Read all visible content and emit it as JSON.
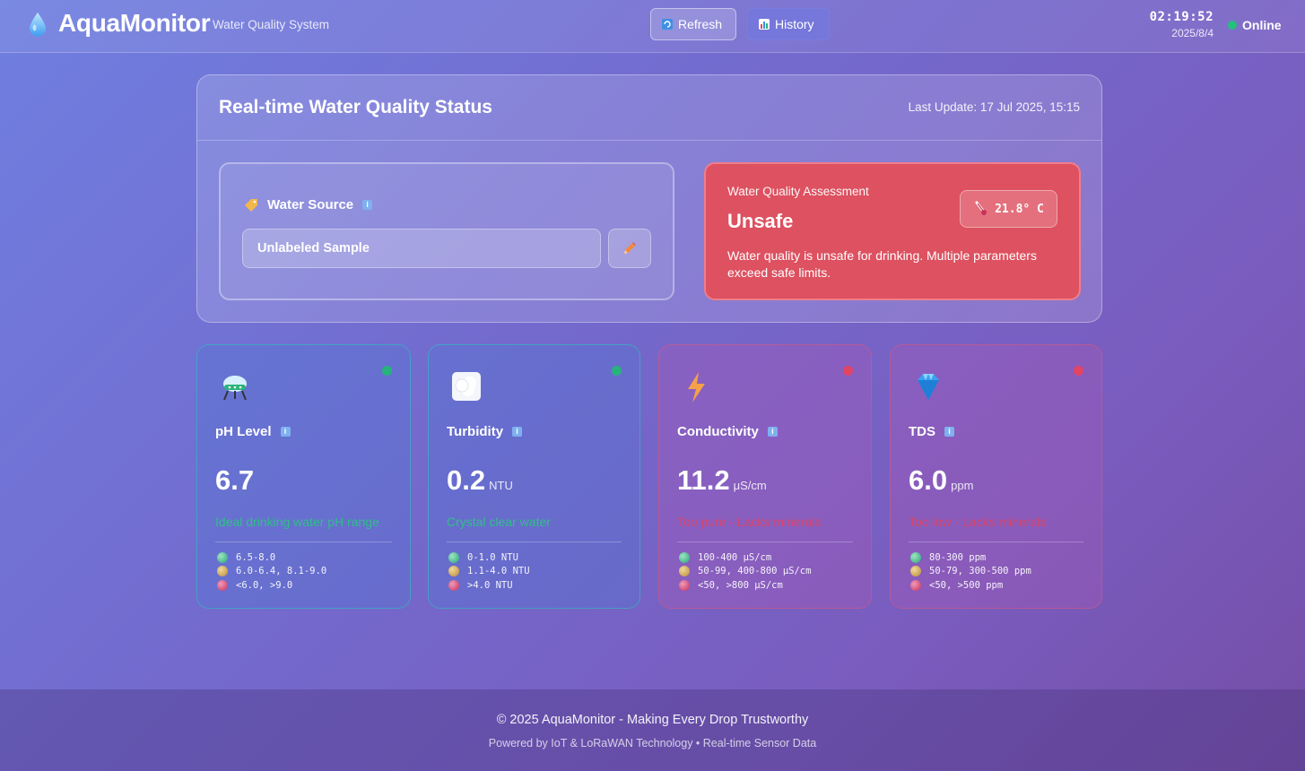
{
  "header": {
    "brand": "AquaMonitor",
    "tagline": "Water Quality System",
    "refresh_label": "Refresh",
    "history_label": "History",
    "time": "02:19:52",
    "date": "2025/8/4",
    "connection_status": "Online"
  },
  "status": {
    "title": "Real-time Water Quality Status",
    "last_update": "Last Update: 17 Jul 2025, 15:15",
    "source": {
      "label": "Water Source",
      "info": "i",
      "value": "Unlabeled Sample"
    },
    "assessment": {
      "label": "Water Quality Assessment",
      "value": "Unsafe",
      "description": "Water quality is unsafe for drinking. Multiple parameters exceed safe limits.",
      "temperature": "21.8° C"
    }
  },
  "metrics": [
    {
      "name": "pH Level",
      "info": "i",
      "value": "6.7",
      "unit": "",
      "description": "Ideal drinking water pH range",
      "status_color": "#27b27e",
      "description_color": "#2fbf88",
      "ranges": [
        "6.5-8.0",
        "6.0-6.4, 8.1-9.0",
        "<6.0, >9.0"
      ]
    },
    {
      "name": "Turbidity",
      "info": "i",
      "value": "0.2",
      "unit": "NTU",
      "description": "Crystal clear water",
      "status_color": "#27b27e",
      "description_color": "#2fbf88",
      "ranges": [
        "0-1.0 NTU",
        "1.1-4.0 NTU",
        ">4.0 NTU"
      ]
    },
    {
      "name": "Conductivity",
      "info": "i",
      "value": "11.2",
      "unit": "μS/cm",
      "description": "Too pure - Lacks minerals",
      "status_color": "#e04565",
      "description_color": "#d8446a",
      "ranges": [
        "100-400 μS/cm",
        "50-99, 400-800 μS/cm",
        "<50, >800 μS/cm"
      ]
    },
    {
      "name": "TDS",
      "info": "i",
      "value": "6.0",
      "unit": "ppm",
      "description": "Too low - Lacks minerals",
      "status_color": "#e04565",
      "description_color": "#d8446a",
      "ranges": [
        "80-300 ppm",
        "50-79, 300-500 ppm",
        "<50, >500 ppm"
      ]
    }
  ],
  "footer": {
    "line1": "© 2025 AquaMonitor - Making Every Drop Trustworthy",
    "line2": "Powered by IoT & LoRaWAN Technology • Real-time Sensor Data"
  },
  "icons": {
    "logo": "water-drop-icon",
    "refresh": "refresh-icon",
    "history": "bar-chart-icon",
    "source": "tag-icon",
    "edit": "pencil-icon",
    "temperature": "thermometer-icon",
    "ph": "test-tube-icon",
    "turbidity": "cloud-icon",
    "conductivity": "lightning-icon",
    "tds": "gem-icon"
  }
}
